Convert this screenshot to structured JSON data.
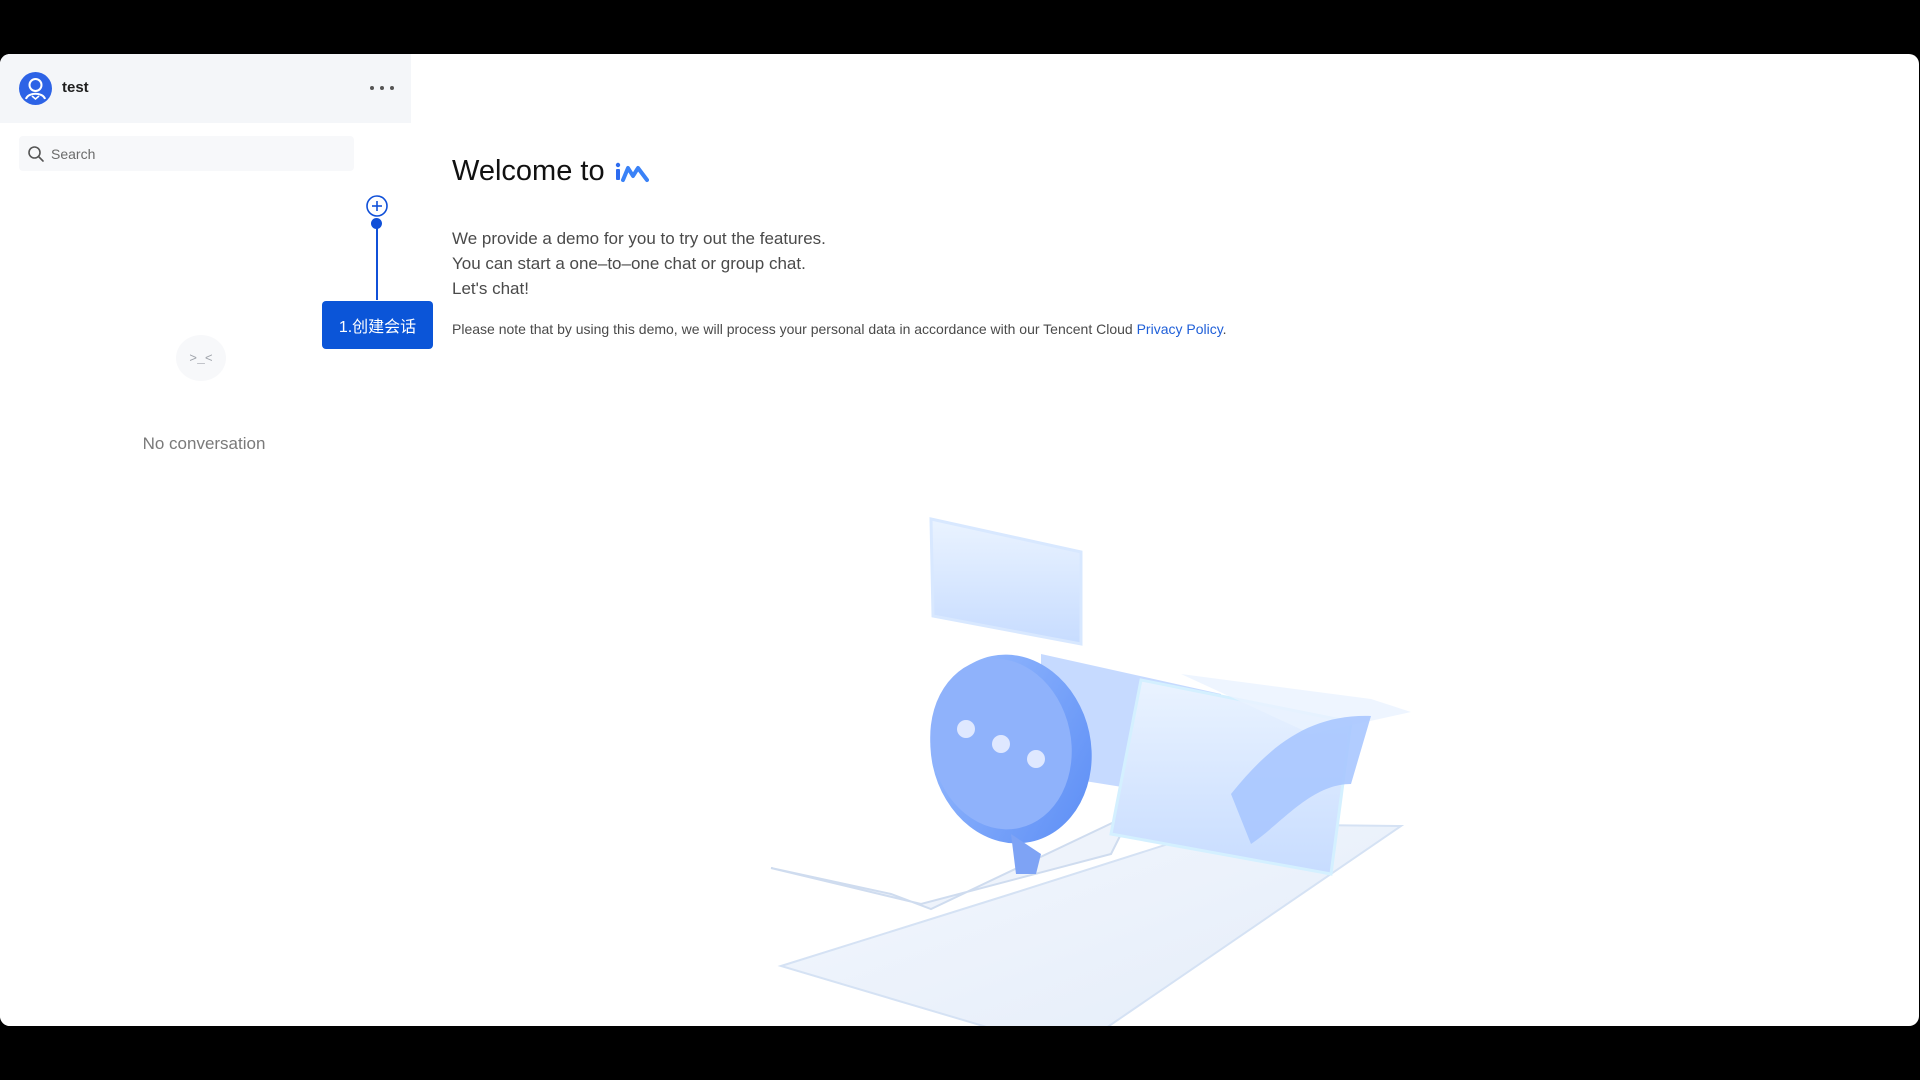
{
  "user": {
    "name": "test"
  },
  "search": {
    "placeholder": "Search"
  },
  "guide": {
    "tip": "1.创建会话"
  },
  "empty": {
    "face": ">_<",
    "text": "No conversation"
  },
  "welcome": {
    "title": "Welcome to",
    "logo_text": "iM",
    "intro_lines": [
      "We provide a demo for you to try out the features.",
      "You can start a one–to–one chat or group chat.",
      "Let's chat!"
    ],
    "notice_prefix": "Please note that by using this demo, we will process your personal data in accordance with our Tencent Cloud ",
    "notice_link": "Privacy Policy",
    "notice_suffix": "."
  },
  "colors": {
    "accent": "#0b55d8",
    "link": "#1f5fd8",
    "sidebar_header": "#f4f6f9"
  },
  "icons": [
    "avatar-icon",
    "more-icon",
    "search-icon",
    "add-icon",
    "chat-bubble-illustration"
  ]
}
